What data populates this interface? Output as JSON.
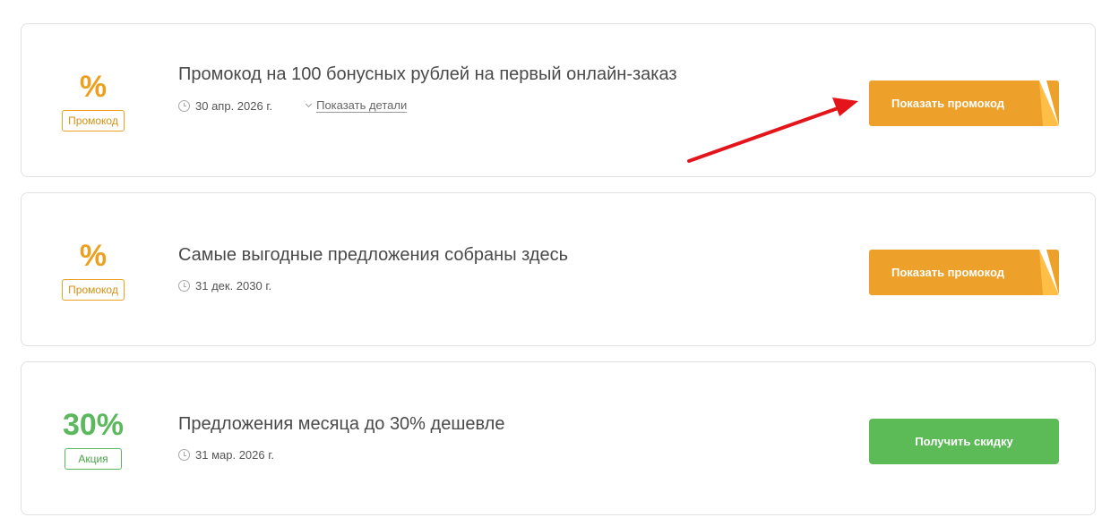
{
  "offers": [
    {
      "value": "%",
      "tag": "Промокод",
      "title": "Промокод на 100 бонусных рублей на первый онлайн-заказ",
      "date": "30 апр. 2026 г.",
      "details_label": "Показать детали",
      "button_label": "Показать промокод"
    },
    {
      "value": "%",
      "tag": "Промокод",
      "title": "Самые выгодные предложения собраны здесь",
      "date": "31 дек. 2030 г.",
      "button_label": "Показать промокод"
    },
    {
      "value": "30%",
      "tag": "Акция",
      "title": "Предложения месяца до 30% дешевле",
      "date": "31 мар. 2026 г.",
      "button_label": "Получить скидку"
    }
  ],
  "colors": {
    "promo_orange": "#eda02a",
    "deal_green": "#5cbb57",
    "arrow_red": "#e3151a"
  },
  "icons": {
    "date": "clock-icon",
    "details": "chevron-down-icon",
    "annotation": "red-arrow-icon"
  }
}
